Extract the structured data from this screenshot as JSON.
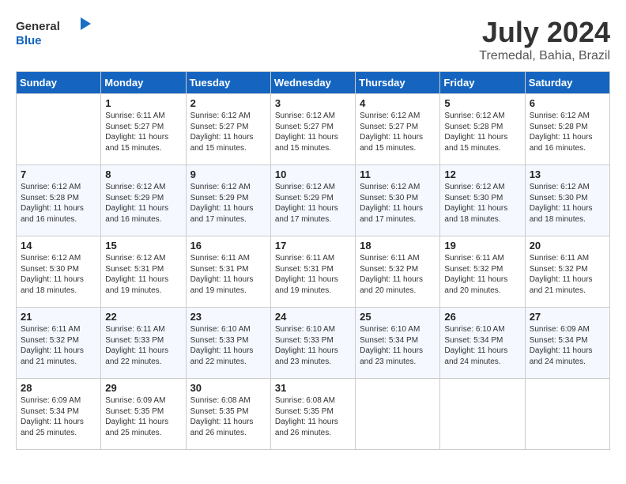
{
  "header": {
    "logo_general": "General",
    "logo_blue": "Blue",
    "month": "July 2024",
    "location": "Tremedal, Bahia, Brazil"
  },
  "weekdays": [
    "Sunday",
    "Monday",
    "Tuesday",
    "Wednesday",
    "Thursday",
    "Friday",
    "Saturday"
  ],
  "weeks": [
    [
      {
        "day": "",
        "sunrise": "",
        "sunset": "",
        "daylight": ""
      },
      {
        "day": "1",
        "sunrise": "6:11 AM",
        "sunset": "5:27 PM",
        "daylight": "11 hours and 15 minutes."
      },
      {
        "day": "2",
        "sunrise": "6:12 AM",
        "sunset": "5:27 PM",
        "daylight": "11 hours and 15 minutes."
      },
      {
        "day": "3",
        "sunrise": "6:12 AM",
        "sunset": "5:27 PM",
        "daylight": "11 hours and 15 minutes."
      },
      {
        "day": "4",
        "sunrise": "6:12 AM",
        "sunset": "5:27 PM",
        "daylight": "11 hours and 15 minutes."
      },
      {
        "day": "5",
        "sunrise": "6:12 AM",
        "sunset": "5:28 PM",
        "daylight": "11 hours and 15 minutes."
      },
      {
        "day": "6",
        "sunrise": "6:12 AM",
        "sunset": "5:28 PM",
        "daylight": "11 hours and 16 minutes."
      }
    ],
    [
      {
        "day": "7",
        "sunrise": "6:12 AM",
        "sunset": "5:28 PM",
        "daylight": "11 hours and 16 minutes."
      },
      {
        "day": "8",
        "sunrise": "6:12 AM",
        "sunset": "5:29 PM",
        "daylight": "11 hours and 16 minutes."
      },
      {
        "day": "9",
        "sunrise": "6:12 AM",
        "sunset": "5:29 PM",
        "daylight": "11 hours and 17 minutes."
      },
      {
        "day": "10",
        "sunrise": "6:12 AM",
        "sunset": "5:29 PM",
        "daylight": "11 hours and 17 minutes."
      },
      {
        "day": "11",
        "sunrise": "6:12 AM",
        "sunset": "5:30 PM",
        "daylight": "11 hours and 17 minutes."
      },
      {
        "day": "12",
        "sunrise": "6:12 AM",
        "sunset": "5:30 PM",
        "daylight": "11 hours and 18 minutes."
      },
      {
        "day": "13",
        "sunrise": "6:12 AM",
        "sunset": "5:30 PM",
        "daylight": "11 hours and 18 minutes."
      }
    ],
    [
      {
        "day": "14",
        "sunrise": "6:12 AM",
        "sunset": "5:30 PM",
        "daylight": "11 hours and 18 minutes."
      },
      {
        "day": "15",
        "sunrise": "6:12 AM",
        "sunset": "5:31 PM",
        "daylight": "11 hours and 19 minutes."
      },
      {
        "day": "16",
        "sunrise": "6:11 AM",
        "sunset": "5:31 PM",
        "daylight": "11 hours and 19 minutes."
      },
      {
        "day": "17",
        "sunrise": "6:11 AM",
        "sunset": "5:31 PM",
        "daylight": "11 hours and 19 minutes."
      },
      {
        "day": "18",
        "sunrise": "6:11 AM",
        "sunset": "5:32 PM",
        "daylight": "11 hours and 20 minutes."
      },
      {
        "day": "19",
        "sunrise": "6:11 AM",
        "sunset": "5:32 PM",
        "daylight": "11 hours and 20 minutes."
      },
      {
        "day": "20",
        "sunrise": "6:11 AM",
        "sunset": "5:32 PM",
        "daylight": "11 hours and 21 minutes."
      }
    ],
    [
      {
        "day": "21",
        "sunrise": "6:11 AM",
        "sunset": "5:32 PM",
        "daylight": "11 hours and 21 minutes."
      },
      {
        "day": "22",
        "sunrise": "6:11 AM",
        "sunset": "5:33 PM",
        "daylight": "11 hours and 22 minutes."
      },
      {
        "day": "23",
        "sunrise": "6:10 AM",
        "sunset": "5:33 PM",
        "daylight": "11 hours and 22 minutes."
      },
      {
        "day": "24",
        "sunrise": "6:10 AM",
        "sunset": "5:33 PM",
        "daylight": "11 hours and 23 minutes."
      },
      {
        "day": "25",
        "sunrise": "6:10 AM",
        "sunset": "5:34 PM",
        "daylight": "11 hours and 23 minutes."
      },
      {
        "day": "26",
        "sunrise": "6:10 AM",
        "sunset": "5:34 PM",
        "daylight": "11 hours and 24 minutes."
      },
      {
        "day": "27",
        "sunrise": "6:09 AM",
        "sunset": "5:34 PM",
        "daylight": "11 hours and 24 minutes."
      }
    ],
    [
      {
        "day": "28",
        "sunrise": "6:09 AM",
        "sunset": "5:34 PM",
        "daylight": "11 hours and 25 minutes."
      },
      {
        "day": "29",
        "sunrise": "6:09 AM",
        "sunset": "5:35 PM",
        "daylight": "11 hours and 25 minutes."
      },
      {
        "day": "30",
        "sunrise": "6:08 AM",
        "sunset": "5:35 PM",
        "daylight": "11 hours and 26 minutes."
      },
      {
        "day": "31",
        "sunrise": "6:08 AM",
        "sunset": "5:35 PM",
        "daylight": "11 hours and 26 minutes."
      },
      {
        "day": "",
        "sunrise": "",
        "sunset": "",
        "daylight": ""
      },
      {
        "day": "",
        "sunrise": "",
        "sunset": "",
        "daylight": ""
      },
      {
        "day": "",
        "sunrise": "",
        "sunset": "",
        "daylight": ""
      }
    ]
  ]
}
